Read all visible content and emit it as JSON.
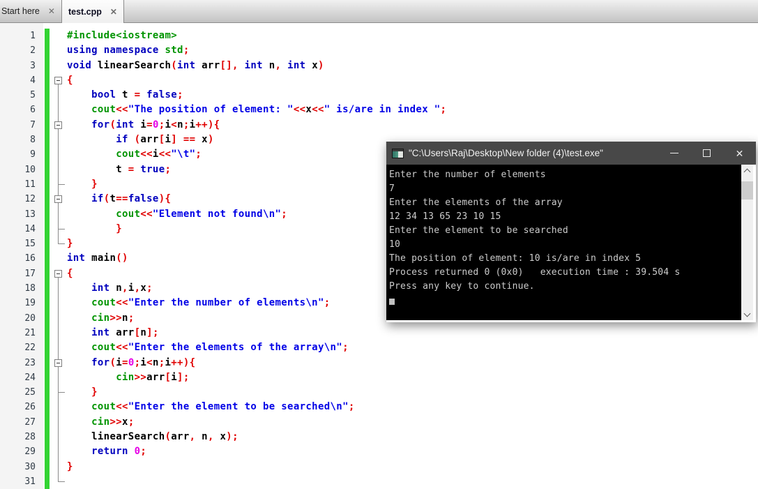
{
  "tabs": [
    {
      "label": "Start here",
      "close": "✕",
      "active": false
    },
    {
      "label": "test.cpp",
      "close": "✕",
      "active": true
    }
  ],
  "palette": {
    "kw": "#0000be",
    "str": "#0000e6",
    "lib": "#009400",
    "op": "#e00000",
    "num": "#e600e6",
    "pl": "#000000",
    "pre": "#009400"
  },
  "editor": {
    "lines": [
      {
        "n": 1,
        "fold": "",
        "segs": [
          [
            "pre",
            "#include<iostream>"
          ]
        ]
      },
      {
        "n": 2,
        "fold": "",
        "segs": [
          [
            "kw",
            "using"
          ],
          [
            "pl",
            " "
          ],
          [
            "kw",
            "namespace"
          ],
          [
            "pl",
            " "
          ],
          [
            "lib",
            "std"
          ],
          [
            "op",
            ";"
          ]
        ]
      },
      {
        "n": 3,
        "fold": "",
        "segs": [
          [
            "kw",
            "void"
          ],
          [
            "pl",
            " linearSearch"
          ],
          [
            "op",
            "("
          ],
          [
            "kw",
            "int"
          ],
          [
            "pl",
            " arr"
          ],
          [
            "op",
            "[],"
          ],
          [
            "pl",
            " "
          ],
          [
            "kw",
            "int"
          ],
          [
            "pl",
            " n"
          ],
          [
            "op",
            ","
          ],
          [
            "pl",
            " "
          ],
          [
            "kw",
            "int"
          ],
          [
            "pl",
            " x"
          ],
          [
            "op",
            ")"
          ]
        ]
      },
      {
        "n": 4,
        "fold": "box0",
        "segs": [
          [
            "op",
            "{"
          ]
        ]
      },
      {
        "n": 5,
        "fold": "v",
        "segs": [
          [
            "pl",
            "    "
          ],
          [
            "kw",
            "bool"
          ],
          [
            "pl",
            " t "
          ],
          [
            "op",
            "="
          ],
          [
            "pl",
            " "
          ],
          [
            "kw",
            "false"
          ],
          [
            "op",
            ";"
          ]
        ]
      },
      {
        "n": 6,
        "fold": "v",
        "segs": [
          [
            "pl",
            "    "
          ],
          [
            "lib",
            "cout"
          ],
          [
            "op",
            "<<"
          ],
          [
            "str",
            "\"The position of element: \""
          ],
          [
            "op",
            "<<"
          ],
          [
            "pl",
            "x"
          ],
          [
            "op",
            "<<"
          ],
          [
            "str",
            "\" is/are in index \""
          ],
          [
            "op",
            ";"
          ]
        ]
      },
      {
        "n": 7,
        "fold": "box1",
        "segs": [
          [
            "pl",
            "    "
          ],
          [
            "kw",
            "for"
          ],
          [
            "op",
            "("
          ],
          [
            "kw",
            "int"
          ],
          [
            "pl",
            " i"
          ],
          [
            "op",
            "="
          ],
          [
            "num",
            "0"
          ],
          [
            "op",
            ";"
          ],
          [
            "pl",
            "i"
          ],
          [
            "op",
            "<"
          ],
          [
            "pl",
            "n"
          ],
          [
            "op",
            ";"
          ],
          [
            "pl",
            "i"
          ],
          [
            "op",
            "++){"
          ]
        ]
      },
      {
        "n": 8,
        "fold": "v",
        "segs": [
          [
            "pl",
            "        "
          ],
          [
            "kw",
            "if"
          ],
          [
            "pl",
            " "
          ],
          [
            "op",
            "("
          ],
          [
            "pl",
            "arr"
          ],
          [
            "op",
            "["
          ],
          [
            "pl",
            "i"
          ],
          [
            "op",
            "]"
          ],
          [
            "pl",
            " "
          ],
          [
            "op",
            "=="
          ],
          [
            "pl",
            " x"
          ],
          [
            "op",
            ")"
          ]
        ]
      },
      {
        "n": 9,
        "fold": "v",
        "segs": [
          [
            "pl",
            "        "
          ],
          [
            "lib",
            "cout"
          ],
          [
            "op",
            "<<"
          ],
          [
            "pl",
            "i"
          ],
          [
            "op",
            "<<"
          ],
          [
            "str",
            "\"\\t\""
          ],
          [
            "op",
            ";"
          ]
        ]
      },
      {
        "n": 10,
        "fold": "v",
        "segs": [
          [
            "pl",
            "        "
          ],
          [
            "pl",
            "t "
          ],
          [
            "op",
            "="
          ],
          [
            "pl",
            " "
          ],
          [
            "kw",
            "true"
          ],
          [
            "op",
            ";"
          ]
        ]
      },
      {
        "n": 11,
        "fold": "tee",
        "segs": [
          [
            "pl",
            "    "
          ],
          [
            "op",
            "}"
          ]
        ]
      },
      {
        "n": 12,
        "fold": "box1",
        "segs": [
          [
            "pl",
            "    "
          ],
          [
            "kw",
            "if"
          ],
          [
            "op",
            "("
          ],
          [
            "pl",
            "t"
          ],
          [
            "op",
            "=="
          ],
          [
            "kw",
            "false"
          ],
          [
            "op",
            "){"
          ]
        ]
      },
      {
        "n": 13,
        "fold": "v",
        "segs": [
          [
            "pl",
            "        "
          ],
          [
            "lib",
            "cout"
          ],
          [
            "op",
            "<<"
          ],
          [
            "str",
            "\"Element not found\\n\""
          ],
          [
            "op",
            ";"
          ]
        ]
      },
      {
        "n": 14,
        "fold": "tee",
        "segs": [
          [
            "pl",
            "        "
          ],
          [
            "op",
            "}"
          ]
        ]
      },
      {
        "n": 15,
        "fold": "end",
        "segs": [
          [
            "op",
            "}"
          ]
        ]
      },
      {
        "n": 16,
        "fold": "",
        "segs": [
          [
            "kw",
            "int"
          ],
          [
            "pl",
            " main"
          ],
          [
            "op",
            "()"
          ]
        ]
      },
      {
        "n": 17,
        "fold": "box0",
        "segs": [
          [
            "op",
            "{"
          ]
        ]
      },
      {
        "n": 18,
        "fold": "v",
        "segs": [
          [
            "pl",
            "    "
          ],
          [
            "kw",
            "int"
          ],
          [
            "pl",
            " n"
          ],
          [
            "op",
            ","
          ],
          [
            "pl",
            "i"
          ],
          [
            "op",
            ","
          ],
          [
            "pl",
            "x"
          ],
          [
            "op",
            ";"
          ]
        ]
      },
      {
        "n": 19,
        "fold": "v",
        "segs": [
          [
            "pl",
            "    "
          ],
          [
            "lib",
            "cout"
          ],
          [
            "op",
            "<<"
          ],
          [
            "str",
            "\"Enter the number of elements\\n\""
          ],
          [
            "op",
            ";"
          ]
        ]
      },
      {
        "n": 20,
        "fold": "v",
        "segs": [
          [
            "pl",
            "    "
          ],
          [
            "lib",
            "cin"
          ],
          [
            "op",
            ">>"
          ],
          [
            "pl",
            "n"
          ],
          [
            "op",
            ";"
          ]
        ]
      },
      {
        "n": 21,
        "fold": "v",
        "segs": [
          [
            "pl",
            "    "
          ],
          [
            "kw",
            "int"
          ],
          [
            "pl",
            " arr"
          ],
          [
            "op",
            "["
          ],
          [
            "pl",
            "n"
          ],
          [
            "op",
            "]"
          ],
          [
            "op",
            ";"
          ]
        ]
      },
      {
        "n": 22,
        "fold": "v",
        "segs": [
          [
            "pl",
            "    "
          ],
          [
            "lib",
            "cout"
          ],
          [
            "op",
            "<<"
          ],
          [
            "str",
            "\"Enter the elements of the array\\n\""
          ],
          [
            "op",
            ";"
          ]
        ]
      },
      {
        "n": 23,
        "fold": "box1",
        "segs": [
          [
            "pl",
            "    "
          ],
          [
            "kw",
            "for"
          ],
          [
            "op",
            "("
          ],
          [
            "pl",
            "i"
          ],
          [
            "op",
            "="
          ],
          [
            "num",
            "0"
          ],
          [
            "op",
            ";"
          ],
          [
            "pl",
            "i"
          ],
          [
            "op",
            "<"
          ],
          [
            "pl",
            "n"
          ],
          [
            "op",
            ";"
          ],
          [
            "pl",
            "i"
          ],
          [
            "op",
            "++){"
          ]
        ]
      },
      {
        "n": 24,
        "fold": "v",
        "segs": [
          [
            "pl",
            "        "
          ],
          [
            "lib",
            "cin"
          ],
          [
            "op",
            ">>"
          ],
          [
            "pl",
            "arr"
          ],
          [
            "op",
            "["
          ],
          [
            "pl",
            "i"
          ],
          [
            "op",
            "]"
          ],
          [
            "op",
            ";"
          ]
        ]
      },
      {
        "n": 25,
        "fold": "tee",
        "segs": [
          [
            "pl",
            "    "
          ],
          [
            "op",
            "}"
          ]
        ]
      },
      {
        "n": 26,
        "fold": "v",
        "segs": [
          [
            "pl",
            "    "
          ],
          [
            "lib",
            "cout"
          ],
          [
            "op",
            "<<"
          ],
          [
            "str",
            "\"Enter the element to be searched\\n\""
          ],
          [
            "op",
            ";"
          ]
        ]
      },
      {
        "n": 27,
        "fold": "v",
        "segs": [
          [
            "pl",
            "    "
          ],
          [
            "lib",
            "cin"
          ],
          [
            "op",
            ">>"
          ],
          [
            "pl",
            "x"
          ],
          [
            "op",
            ";"
          ]
        ]
      },
      {
        "n": 28,
        "fold": "v",
        "segs": [
          [
            "pl",
            "    "
          ],
          [
            "pl",
            "linearSearch"
          ],
          [
            "op",
            "("
          ],
          [
            "pl",
            "arr"
          ],
          [
            "op",
            ","
          ],
          [
            "pl",
            " n"
          ],
          [
            "op",
            ","
          ],
          [
            "pl",
            " x"
          ],
          [
            "op",
            ");"
          ]
        ]
      },
      {
        "n": 29,
        "fold": "v",
        "segs": [
          [
            "pl",
            "    "
          ],
          [
            "kw",
            "return"
          ],
          [
            "pl",
            " "
          ],
          [
            "num",
            "0"
          ],
          [
            "op",
            ";"
          ]
        ]
      },
      {
        "n": 30,
        "fold": "v",
        "segs": [
          [
            "op",
            "}"
          ]
        ]
      },
      {
        "n": 31,
        "fold": "end",
        "segs": []
      }
    ]
  },
  "console": {
    "title": "\"C:\\Users\\Raj\\Desktop\\New folder (4)\\test.exe\"",
    "controls": {
      "minimize": "minimize",
      "maximize": "maximize",
      "close": "✕"
    },
    "lines": [
      "Enter the number of elements",
      "7",
      "Enter the elements of the array",
      "12 34 13 65 23 10 15",
      "Enter the element to be searched",
      "10",
      "The position of element: 10 is/are in index 5",
      "Process returned 0 (0x0)   execution time : 39.504 s",
      "Press any key to continue."
    ],
    "cursor": true,
    "colors": {
      "titlebar": "#484848",
      "bg": "#000000",
      "fg": "#cccccc"
    }
  }
}
